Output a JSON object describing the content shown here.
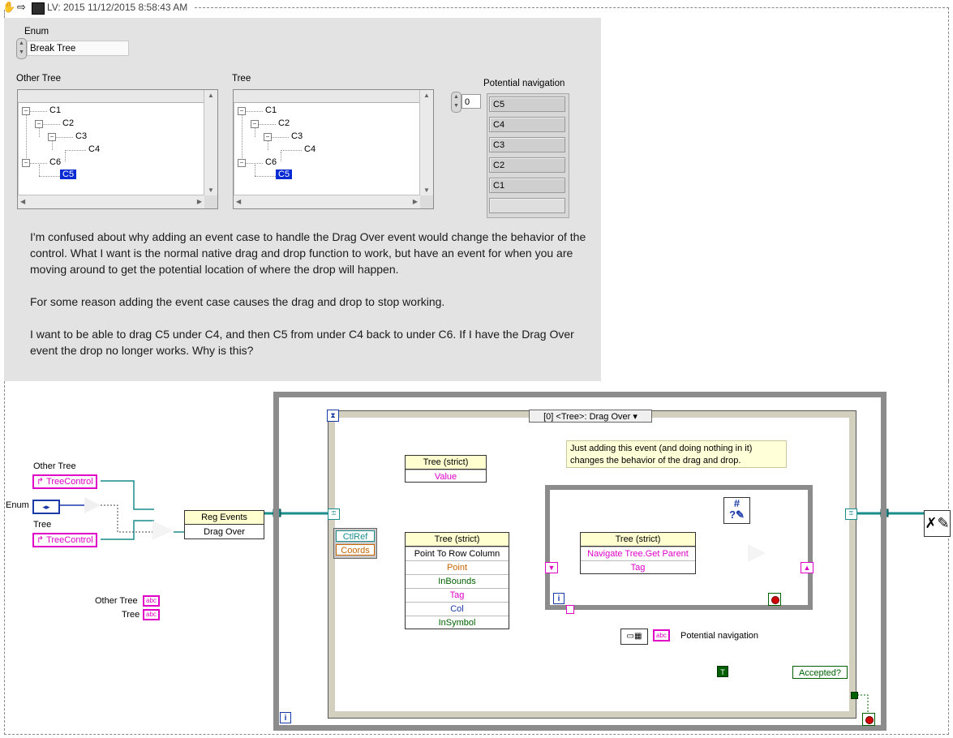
{
  "header": {
    "title": "LV: 2015 11/12/2015 8:58:43 AM"
  },
  "frontpanel": {
    "enum": {
      "label": "Enum",
      "value": "Break Tree"
    },
    "other_tree": {
      "label": "Other Tree",
      "items": [
        "C1",
        "C2",
        "C3",
        "C4",
        "C6",
        "C5"
      ]
    },
    "tree": {
      "label": "Tree",
      "items": [
        "C1",
        "C2",
        "C3",
        "C4",
        "C6",
        "C5"
      ]
    },
    "index": {
      "value": "0"
    },
    "potential_nav": {
      "label": "Potential navigation",
      "items": [
        "C5",
        "C4",
        "C3",
        "C2",
        "C1",
        ""
      ]
    },
    "note": [
      "I'm confused about why adding an event case to handle the Drag Over event would change the behavior of the control.  What I want is the normal native drag and drop function to work, but have an event for when you are moving around to get the potential location of where the drop will happen.",
      "For some reason adding the event case causes the drag and drop to stop working.",
      "I want to be able to drag C5 under C4, and then C5 from under C4 back to under C6.  If I have the Drag Over event the drop no longer works.  Why is this?"
    ]
  },
  "diagram": {
    "other_tree_label": "Other Tree",
    "other_tree_ref": "TreeControl",
    "enum_label": "Enum",
    "tree_label": "Tree",
    "tree_ref": "TreeControl",
    "reg_events": {
      "title": "Reg Events",
      "row": "Drag Over"
    },
    "locals": [
      "Other Tree",
      "Tree"
    ],
    "local_glyph": "abc",
    "case_selector": "[0] <Tree>: Drag Over",
    "comment": "Just adding this event (and doing nothing in it) changes the behavior of the drag and drop.",
    "prop_node": {
      "title": "Tree (strict)",
      "row": "Value"
    },
    "event_data": [
      "CtlRef",
      "Coords"
    ],
    "invoke_node": {
      "title": "Tree (strict)",
      "method": "Point To Row Column",
      "rows": [
        "Point",
        "InBounds",
        "Tag",
        "Col",
        "InSymbol"
      ]
    },
    "invoke2_node": {
      "title": "Tree (strict)",
      "method": "Navigate Tree.Get Parent",
      "rows": [
        "Tag"
      ]
    },
    "potential_nav_terminal": "Potential navigation",
    "accepted": "Accepted?",
    "true_const": "T",
    "iteration": "i"
  }
}
